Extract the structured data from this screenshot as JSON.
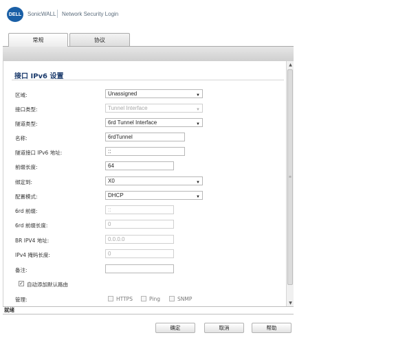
{
  "header": {
    "logo_text": "DELL",
    "brand": "SonicWALL",
    "subtitle": "Network Security Login"
  },
  "tabs": [
    {
      "label": "常规",
      "active": true
    },
    {
      "label": "协议",
      "active": false
    }
  ],
  "section": {
    "title": "接口 IPv6 设置"
  },
  "form": {
    "zone": {
      "label": "区域:",
      "value": "Unassigned"
    },
    "interface_type": {
      "label": "接口类型:",
      "value": "Tunnel Interface"
    },
    "tunnel_type": {
      "label": "隧道类型:",
      "value": "6rd Tunnel Interface"
    },
    "name": {
      "label": "名称:",
      "value": "6rdTunnel"
    },
    "tunnel_ipv6": {
      "label": "隧道接口 IPv6 地址:",
      "value": "::"
    },
    "prefix_length": {
      "label": "前缀长度:",
      "value": "64"
    },
    "bind_to": {
      "label": "绑定到:",
      "value": "X0"
    },
    "config_mode": {
      "label": "配置模式:",
      "value": "DHCP"
    },
    "rd_prefix": {
      "label": "6rd 前缀:",
      "value": "::"
    },
    "rd_prefix_length": {
      "label": "6rd 前缀长度:",
      "value": "0"
    },
    "br_ipv4": {
      "label": "BR IPV4 地址:",
      "value": "0.0.0.0"
    },
    "ipv4_mask_length": {
      "label": "IPv4 掩码长度:",
      "value": "0"
    },
    "comment": {
      "label": "备注:",
      "value": ""
    },
    "auto_default_route": {
      "label": "自动添加默认路由",
      "checked": true
    },
    "management": {
      "label": "管理:",
      "options": [
        {
          "label": "HTTPS",
          "checked": false
        },
        {
          "label": "Ping",
          "checked": false
        },
        {
          "label": "SNMP",
          "checked": false
        }
      ]
    }
  },
  "status": {
    "text": "就绪"
  },
  "buttons": {
    "ok": "确定",
    "cancel": "取消",
    "help": "帮助"
  },
  "colors": {
    "title": "#1a3a6b",
    "logo": "#1a5fa6"
  }
}
